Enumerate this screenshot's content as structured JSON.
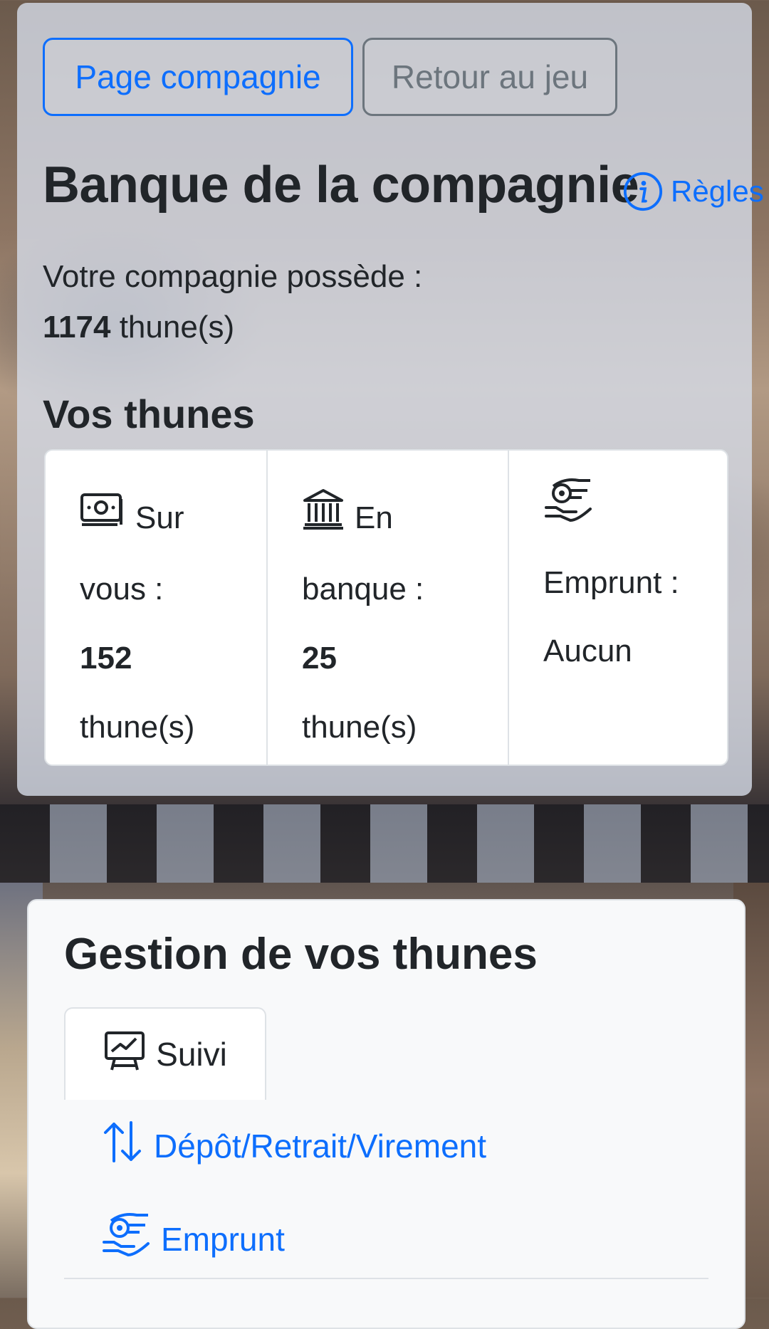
{
  "buttons": {
    "company_page": "Page compagnie",
    "back_to_game": "Retour au jeu"
  },
  "header": {
    "title": "Banque de la compagnie",
    "rules_link": "Règles"
  },
  "company": {
    "owns_label": "Votre compagnie possède :",
    "amount": "1174",
    "unit": " thune(s)"
  },
  "your_money": {
    "title": "Vos thunes",
    "on_you": {
      "label_1": "Sur",
      "label_2": "vous :",
      "amount": "152",
      "unit": "thune(s)",
      "icon": "money-bill-icon"
    },
    "in_bank": {
      "label_1": "En",
      "label_2": "banque :",
      "amount": "25",
      "unit": "thune(s)",
      "icon": "bank-icon"
    },
    "loan": {
      "label": "Emprunt :",
      "value": "Aucun",
      "icon": "hand-coin-icon"
    }
  },
  "management": {
    "title": "Gestion de vos thunes",
    "tabs": [
      {
        "label": "Suivi",
        "icon": "presentation-chart-icon",
        "active": true
      },
      {
        "label": "Dépôt/Retrait/Virement",
        "icon": "arrows-up-down-icon"
      },
      {
        "label": "Emprunt",
        "icon": "hand-coin-icon"
      }
    ]
  },
  "colors": {
    "primary": "#0d6efd",
    "secondary": "#6c757d",
    "text": "#212529"
  }
}
